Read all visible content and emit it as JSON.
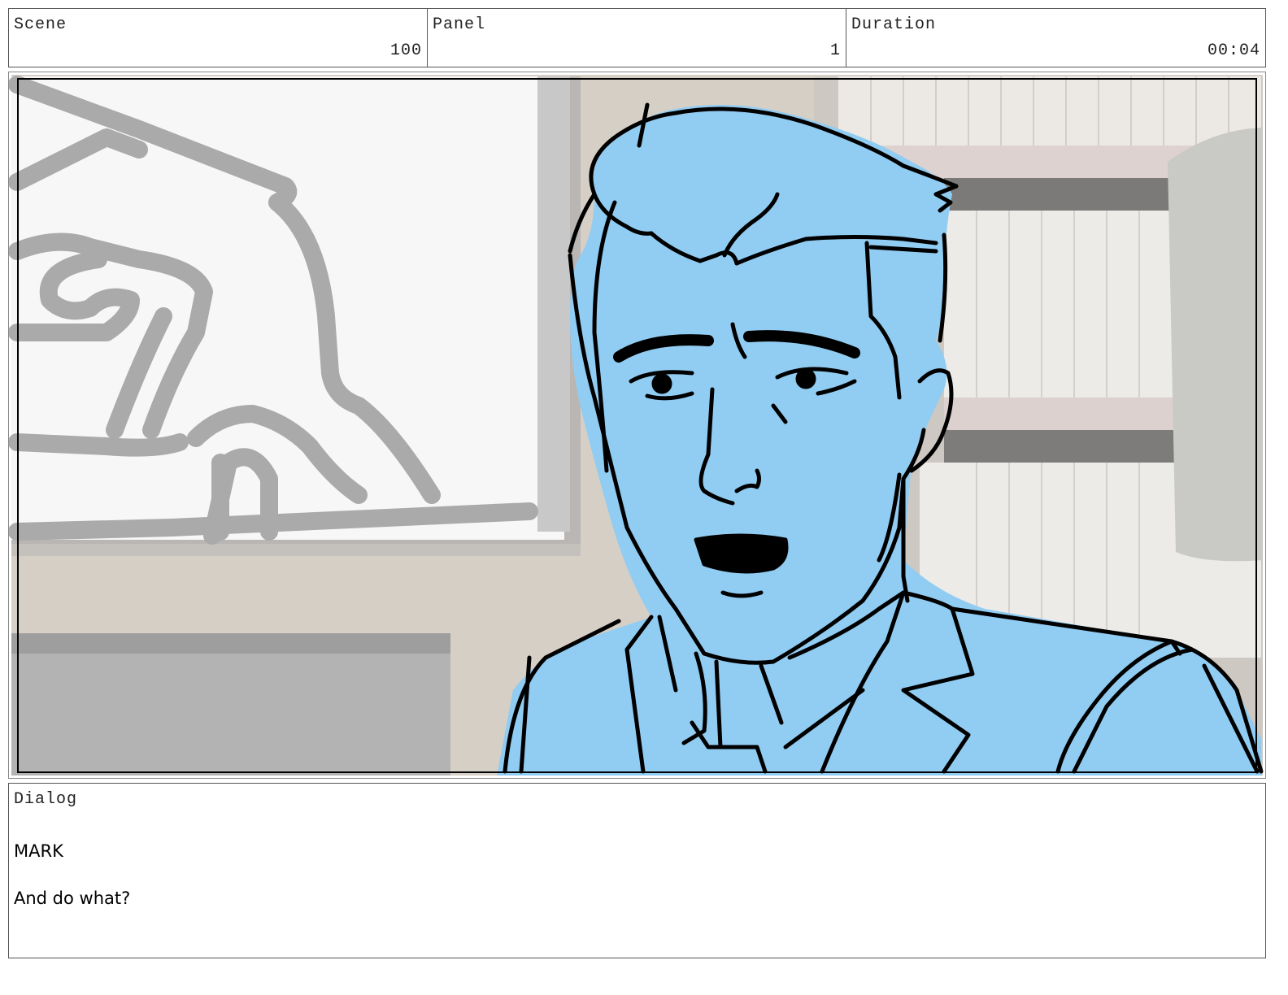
{
  "header": {
    "scene_label": "Scene",
    "scene_value": "100",
    "panel_label": "Panel",
    "panel_value": "1",
    "duration_label": "Duration",
    "duration_value": "00:04"
  },
  "dialog": {
    "label": "Dialog",
    "character": "MARK",
    "line": "And do what?"
  }
}
